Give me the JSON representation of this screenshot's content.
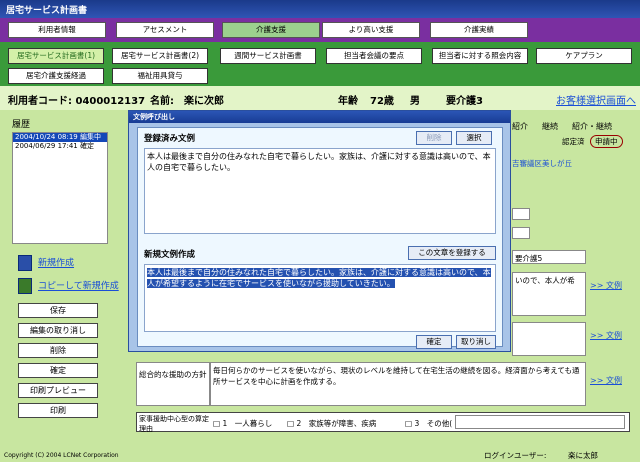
{
  "app_title": "居宅サービス計画書",
  "top_nav": [
    "利用者情報",
    "アセスメント",
    "介護支援",
    "より高い支援",
    "介護実績"
  ],
  "sub_nav_row1": [
    "居宅サービス計画書(1)",
    "居宅サービス計画書(2)",
    "週間サービス計画書",
    "担当者会議の要点",
    "担当者に対する照会内容",
    "ケアプラン"
  ],
  "sub_nav_row2": [
    "居宅介護支援経過",
    "福祉用具貸与"
  ],
  "info": {
    "user_code": "利用者コード: 0400012137",
    "name_label": "名前:",
    "name": "楽に次郎",
    "age_label": "年齢",
    "age": "72歳",
    "gender": "男",
    "care_level": "要介護3",
    "client_select": "お客様選択画面へ"
  },
  "history": {
    "label": "履歴",
    "items": [
      "2004/10/24 08:19 編集中",
      "2004/06/29 17:41 確定"
    ]
  },
  "side": {
    "new_create": "新規作成",
    "copy_new": "コピーして新規作成",
    "buttons": [
      "保存",
      "編集の取り消し",
      "削除",
      "確定",
      "印刷プレビュー",
      "印刷"
    ]
  },
  "bg": {
    "tabs": [
      "紹介",
      "継続",
      "紹介・継続"
    ],
    "certified": "認定済",
    "applying": "申請中",
    "address": "吉審議区美しが丘",
    "care_level_box": "要介護5",
    "box1_text": "いので、本人が希",
    "link": ">> 文例",
    "support_label": "総合的な援助の方針",
    "support_text": "毎日何らかのサービスを使いながら、現状のレベルを維持して在宅生活の継続を図る。経済面から考えても通所サービスを中心に計画を作成する。",
    "reason_label": "家事援助中心型の算定理由",
    "reasons": [
      "□ 1　一人暮らし",
      "□ 2　家族等が障害、疾病",
      "□ 3　その他("
    ]
  },
  "modal": {
    "title": "文例呼び出し",
    "registered_label": "登録済み文例",
    "delete_btn": "削除",
    "select_btn": "選択",
    "registered_text": "本人は最後まで自分の住みなれた自宅で暮らしたい。家族は、介護に対する意識は高いので、本人の自宅で暮らしたい。",
    "new_label": "新規文例作成",
    "register_btn": "この文章を登録する",
    "new_text": "本人は最後まで自分の住みなれた自宅で暮らしたい。家族は、介護に対する意識は高いので、本人が希望するように在宅でサービスを使いながら援助していきたい。",
    "ok_btn": "確定",
    "cancel_btn": "取り消し"
  },
  "footer": {
    "copyright": "Copyright (C) 2004 LCNet Corporation",
    "login_label": "ログインユーザー:",
    "login_name": "楽に太郎"
  }
}
